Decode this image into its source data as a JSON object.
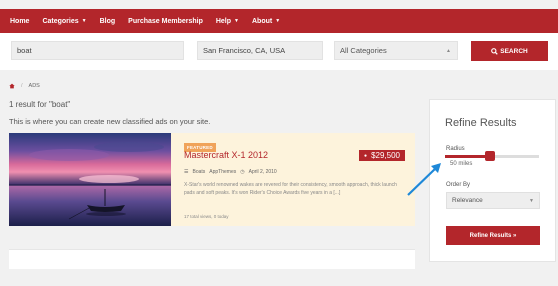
{
  "nav": {
    "items": [
      {
        "label": "Home",
        "dropdown": false
      },
      {
        "label": "Categories",
        "dropdown": true
      },
      {
        "label": "Blog",
        "dropdown": false
      },
      {
        "label": "Purchase Membership",
        "dropdown": false
      },
      {
        "label": "Help",
        "dropdown": true
      },
      {
        "label": "About",
        "dropdown": true
      }
    ]
  },
  "search": {
    "keyword": "boat",
    "location": "San Francisco, CA, USA",
    "category": "All Categories",
    "button": "SEARCH"
  },
  "breadcrumb": {
    "home_icon": "home-icon",
    "current": "ADS"
  },
  "results": {
    "count_text": "1 result for \"boat\"",
    "subtitle": "This is where you can create new classified ads on your site."
  },
  "listing": {
    "badge": "FEATURED",
    "title": "Mastercraft X-1 2012",
    "price": "$29,500",
    "category": "Boats",
    "author": "AppThemes",
    "date": "April 2, 2010",
    "description": "X-Star's world renowned wakes are revered for their consistency, smooth approach, thick launch pads and soft peaks. It's won Rider's Choice Awards five years in a [...]",
    "views": "17 total views, 0 today"
  },
  "sidebar": {
    "title": "Refine Results",
    "radius_label": "Radius",
    "radius_value": "50 miles",
    "radius_fraction": 0.48,
    "order_label": "Order By",
    "order_value": "Relevance",
    "button": "Refine Results »"
  },
  "colors": {
    "brand": "#b3262b",
    "featured": "#f0a35a",
    "listing_bg": "#fdf3dc",
    "annotation_arrow": "#1e88d8"
  }
}
